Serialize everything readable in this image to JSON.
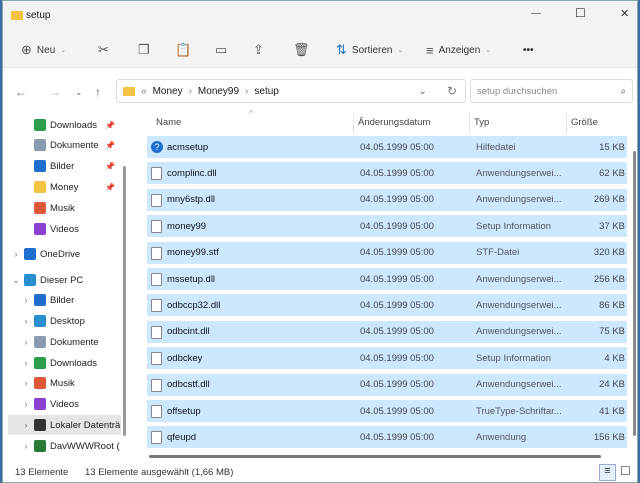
{
  "window": {
    "title": "setup",
    "minimize": "—",
    "maximize": "☐",
    "close": "✕"
  },
  "toolbar": {
    "new": "Neu",
    "sort": "Sortieren",
    "view": "Anzeigen",
    "more": "•••"
  },
  "address": {
    "overflow": "«",
    "crumbs": [
      "Money",
      "Money99",
      "setup"
    ],
    "search_placeholder": "setup durchsuchen"
  },
  "sidebar": {
    "quick": [
      {
        "label": "Downloads",
        "color": "#2a9d4a"
      },
      {
        "label": "Dokumente",
        "color": "#8a9bb0"
      },
      {
        "label": "Bilder",
        "color": "#1e6fd0"
      },
      {
        "label": "Money",
        "color": "#f5c342"
      },
      {
        "label": "Musik",
        "color": "#e0573a"
      },
      {
        "label": "Videos",
        "color": "#8a3fd0"
      }
    ],
    "onedrive": "OneDrive",
    "thispc": "Dieser PC",
    "pc": [
      {
        "label": "Bilder",
        "color": "#1e6fd0"
      },
      {
        "label": "Desktop",
        "color": "#2a8fd0"
      },
      {
        "label": "Dokumente",
        "color": "#8a9bb0"
      },
      {
        "label": "Downloads",
        "color": "#2a9d4a"
      },
      {
        "label": "Musik",
        "color": "#e0573a"
      },
      {
        "label": "Videos",
        "color": "#8a3fd0"
      },
      {
        "label": "Lokaler Datenträ",
        "color": "#333"
      },
      {
        "label": "DavWWWRoot (",
        "color": "#2a7a3a"
      }
    ]
  },
  "columns": {
    "name": "Name",
    "date": "Änderungsdatum",
    "type": "Typ",
    "size": "Größe"
  },
  "files": [
    {
      "name": "acmsetup",
      "date": "04.05.1999 05:00",
      "type": "Hilfedatei",
      "size": "15 KB"
    },
    {
      "name": "complinc.dll",
      "date": "04.05.1999 05:00",
      "type": "Anwendungserwei...",
      "size": "62 KB"
    },
    {
      "name": "mny6stp.dll",
      "date": "04.05.1999 05:00",
      "type": "Anwendungserwei...",
      "size": "269 KB"
    },
    {
      "name": "money99",
      "date": "04.05.1999 05:00",
      "type": "Setup Information",
      "size": "37 KB"
    },
    {
      "name": "money99.stf",
      "date": "04.05.1999 05:00",
      "type": "STF-Datei",
      "size": "320 KB"
    },
    {
      "name": "mssetup.dll",
      "date": "04.05.1999 05:00",
      "type": "Anwendungserwei...",
      "size": "256 KB"
    },
    {
      "name": "odbccp32.dll",
      "date": "04.05.1999 05:00",
      "type": "Anwendungserwei...",
      "size": "86 KB"
    },
    {
      "name": "odbcint.dll",
      "date": "04.05.1999 05:00",
      "type": "Anwendungserwei...",
      "size": "75 KB"
    },
    {
      "name": "odbckey",
      "date": "04.05.1999 05:00",
      "type": "Setup Information",
      "size": "4 KB"
    },
    {
      "name": "odbcstf.dll",
      "date": "04.05.1999 05:00",
      "type": "Anwendungserwei...",
      "size": "24 KB"
    },
    {
      "name": "offsetup",
      "date": "04.05.1999 05:00",
      "type": "TrueType-Schriftar...",
      "size": "41 KB"
    },
    {
      "name": "qfeupd",
      "date": "04.05.1999 05:00",
      "type": "Anwendung",
      "size": "156 KB"
    }
  ],
  "status": {
    "count": "13 Elemente",
    "selected": "13 Elemente ausgewählt (1,66 MB)"
  }
}
